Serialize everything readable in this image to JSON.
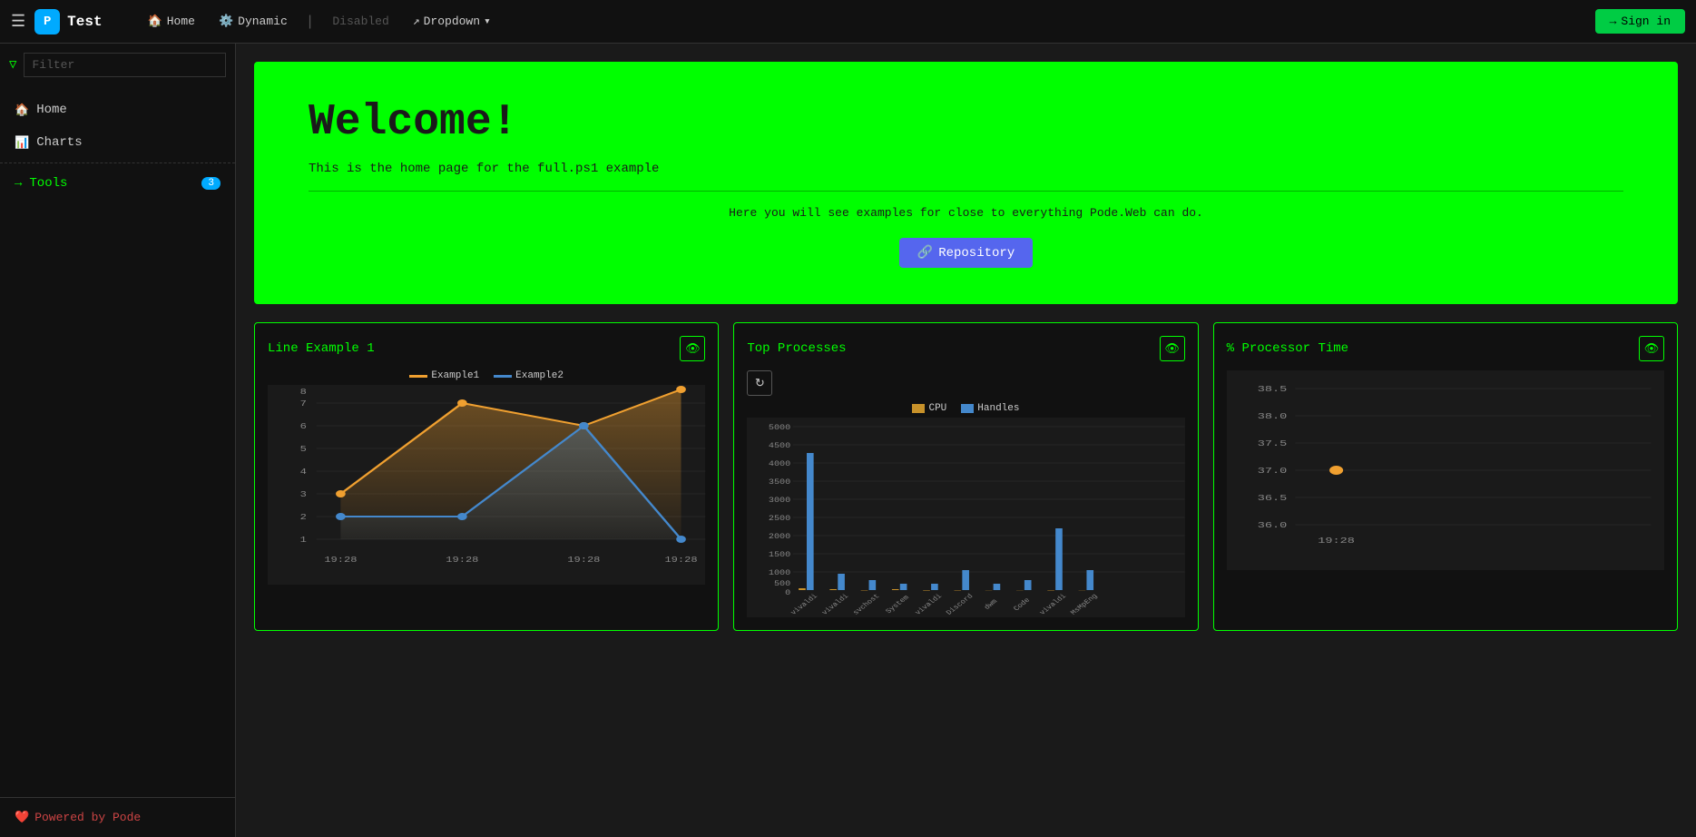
{
  "app": {
    "title": "Test",
    "logo_text": "P"
  },
  "nav": {
    "home_label": "Home",
    "dynamic_label": "Dynamic",
    "disabled_label": "Disabled",
    "dropdown_label": "Dropdown",
    "sign_in_label": "Sign in"
  },
  "sidebar": {
    "filter_placeholder": "Filter",
    "items": [
      {
        "id": "home",
        "label": "Home",
        "icon": "🏠"
      },
      {
        "id": "charts",
        "label": "Charts",
        "icon": "📊"
      },
      {
        "id": "tools",
        "label": "Tools",
        "icon": "→",
        "badge": "3"
      }
    ],
    "footer_label": "Powered by Pode"
  },
  "hero": {
    "title": "Welcome!",
    "subtitle": "This is the home page for the full.ps1 example",
    "description": "Here you will see examples for close to everything Pode.Web can do.",
    "repo_btn_label": "Repository"
  },
  "charts": {
    "line_chart": {
      "title": "Line Example 1",
      "legend": [
        {
          "label": "Example1",
          "color": "#f0a030"
        },
        {
          "label": "Example2",
          "color": "#4488cc"
        }
      ],
      "x_labels": [
        "19:28",
        "19:28",
        "19:28",
        "19:28"
      ],
      "y_labels": [
        "1",
        "2",
        "3",
        "4",
        "5",
        "6",
        "7",
        "8"
      ],
      "series1": [
        3,
        7,
        6,
        8
      ],
      "series2": [
        2,
        2,
        6,
        1
      ]
    },
    "bar_chart": {
      "title": "Top Processes",
      "legend": [
        {
          "label": "CPU",
          "color": "#c8922a"
        },
        {
          "label": "Handles",
          "color": "#4488cc"
        }
      ],
      "y_labels": [
        "500",
        "1000",
        "1500",
        "2000",
        "2500",
        "3000",
        "3500",
        "4000",
        "4500",
        "5000"
      ],
      "x_labels": [
        "vivaldi",
        "vivaldi",
        "svchost",
        "System",
        "vivaldi",
        "Discord",
        "dwm",
        "Code",
        "vivaldi",
        "MsMpEng"
      ],
      "cpu_values": [
        50,
        30,
        10,
        20,
        15,
        10,
        5,
        5,
        10,
        5
      ],
      "handles_values": [
        4200,
        500,
        300,
        200,
        200,
        600,
        200,
        300,
        1900,
        600
      ]
    },
    "processor_chart": {
      "title": "% Processor Time",
      "y_labels": [
        "36.0",
        "36.5",
        "37.0",
        "37.5",
        "38.0",
        "38.5"
      ],
      "x_labels": [
        "19:28"
      ],
      "data_point": 37.0
    }
  }
}
